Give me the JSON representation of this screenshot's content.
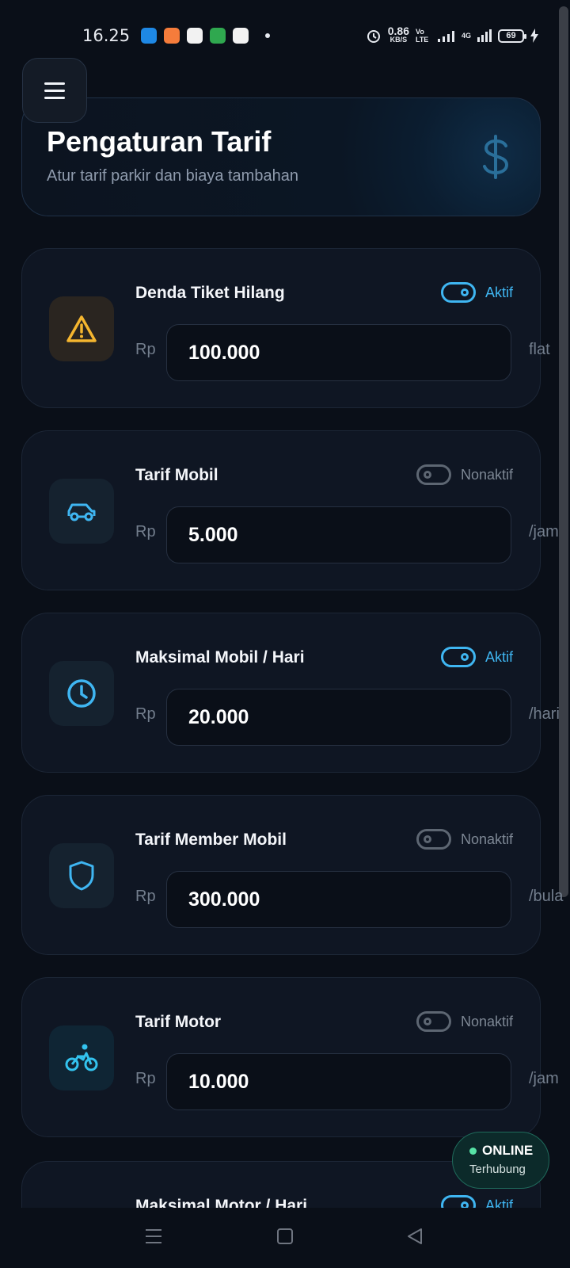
{
  "status_bar": {
    "time": "16.25",
    "net_speed_value": "0.86",
    "net_speed_unit": "KB/S",
    "volte": "Vo LTE",
    "network": "4G",
    "battery": "69"
  },
  "header": {
    "title": "Pengaturan Tarif",
    "subtitle": "Atur tarif parkir dan biaya tambahan",
    "icon": "dollar-icon"
  },
  "tariffs": [
    {
      "title": "Denda Tiket Hilang",
      "status": "Aktif",
      "active": true,
      "currency": "Rp",
      "value": "100.000",
      "unit": "flat",
      "icon": "warning-icon",
      "icon_color": "#f5b62f",
      "icon_bg": "#2a2520"
    },
    {
      "title": "Tarif Mobil",
      "status": "Nonaktif",
      "active": false,
      "currency": "Rp",
      "value": "5.000",
      "unit": "/jam",
      "icon": "car-icon",
      "icon_color": "#3fb6f2",
      "icon_bg": "#15222f"
    },
    {
      "title": "Maksimal Mobil / Hari",
      "status": "Aktif",
      "active": true,
      "currency": "Rp",
      "value": "20.000",
      "unit": "/hari",
      "icon": "clock-icon",
      "icon_color": "#3fb6f2",
      "icon_bg": "#15222f"
    },
    {
      "title": "Tarif Member Mobil",
      "status": "Nonaktif",
      "active": false,
      "currency": "Rp",
      "value": "300.000",
      "unit": "/bula",
      "icon": "shield-icon",
      "icon_color": "#3fb6f2",
      "icon_bg": "#15222f"
    },
    {
      "title": "Tarif Motor",
      "status": "Nonaktif",
      "active": false,
      "currency": "Rp",
      "value": "10.000",
      "unit": "/jam",
      "icon": "bike-icon",
      "icon_color": "#33c3ee",
      "icon_bg": "#0f2534"
    },
    {
      "title": "Maksimal Motor / Hari",
      "status": "Aktif",
      "active": true
    }
  ],
  "online_badge": {
    "label": "ONLINE",
    "sub": "Terhubung"
  },
  "colors": {
    "accent": "#3fb6f2",
    "warning": "#f5b62f",
    "online": "#57e3a6",
    "background": "#0a0f18"
  }
}
